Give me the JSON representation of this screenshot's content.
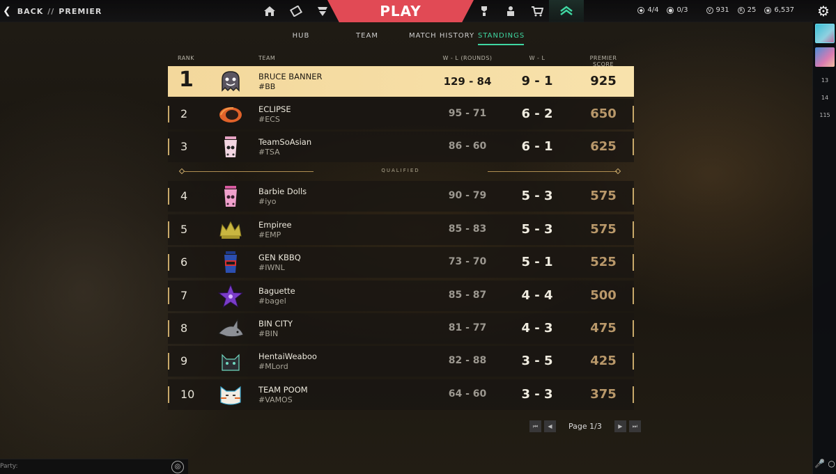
{
  "topbar": {
    "back_label": "BACK",
    "separator": "//",
    "section": "PREMIER",
    "play_label": "PLAY",
    "currencies": [
      {
        "icon": "agent-contract-icon",
        "value": "4/4"
      },
      {
        "icon": "weekly-mission-icon",
        "value": "0/3"
      },
      {
        "icon": "valorant-points-icon",
        "value": "931"
      },
      {
        "icon": "radianite-icon",
        "value": "25"
      },
      {
        "icon": "kingdom-credits-icon",
        "value": "6,537"
      }
    ]
  },
  "subtabs": [
    "HUB",
    "TEAM",
    "MATCH HISTORY",
    "STANDINGS"
  ],
  "active_subtab": "STANDINGS",
  "columns": {
    "rank": "RANK",
    "team": "TEAM",
    "rounds": "W - L (ROUNDS)",
    "wl": "W - L",
    "score": "PREMIER SCORE"
  },
  "qualified_label": "QUALIFIED",
  "standings": [
    {
      "rank": "1",
      "name": "BRUCE BANNER",
      "tag": "#BB",
      "rounds": "129 - 84",
      "wl": "9 - 1",
      "score": "925",
      "logo": "ghost-logo"
    },
    {
      "rank": "2",
      "name": "ECLIPSE",
      "tag": "#ECS",
      "rounds": "95 - 71",
      "wl": "6 - 2",
      "score": "650",
      "logo": "eclipse-logo"
    },
    {
      "rank": "3",
      "name": "TeamSoAsian",
      "tag": "#TSA",
      "rounds": "86 - 60",
      "wl": "6 - 1",
      "score": "625",
      "logo": "boba-skull-logo"
    },
    {
      "rank": "4",
      "name": "Barbie Dolls",
      "tag": "#iyo",
      "rounds": "90 - 79",
      "wl": "5 - 3",
      "score": "575",
      "logo": "pink-boba-logo"
    },
    {
      "rank": "5",
      "name": "Empiree",
      "tag": "#EMP",
      "rounds": "85 - 83",
      "wl": "5 - 3",
      "score": "575",
      "logo": "crown-logo"
    },
    {
      "rank": "6",
      "name": "GEN KBBQ",
      "tag": "#IWNL",
      "rounds": "73 - 70",
      "wl": "5 - 1",
      "score": "525",
      "logo": "cup-logo"
    },
    {
      "rank": "7",
      "name": "Baguette",
      "tag": "#bagel",
      "rounds": "85 - 87",
      "wl": "4 - 4",
      "score": "500",
      "logo": "star-logo"
    },
    {
      "rank": "8",
      "name": "BIN CITY",
      "tag": "#BIN",
      "rounds": "81 - 77",
      "wl": "4 - 3",
      "score": "475",
      "logo": "shark-logo"
    },
    {
      "rank": "9",
      "name": "HentaiWeaboo",
      "tag": "#MLord",
      "rounds": "82 - 88",
      "wl": "3 - 5",
      "score": "425",
      "logo": "cat-logo"
    },
    {
      "rank": "10",
      "name": "TEAM POOM",
      "tag": "#VAMOS",
      "rounds": "64 - 60",
      "wl": "3 - 3",
      "score": "375",
      "logo": "fox-logo"
    }
  ],
  "pager": {
    "label": "Page 1/3"
  },
  "party": {
    "label": "Party:"
  },
  "rightbar": {
    "counts": [
      "13",
      "14",
      "115"
    ]
  },
  "colors": {
    "accent": "#3fd7a2",
    "play": "#e14a55",
    "gold": "#c8a96a",
    "first_row": "#f5dca2"
  }
}
